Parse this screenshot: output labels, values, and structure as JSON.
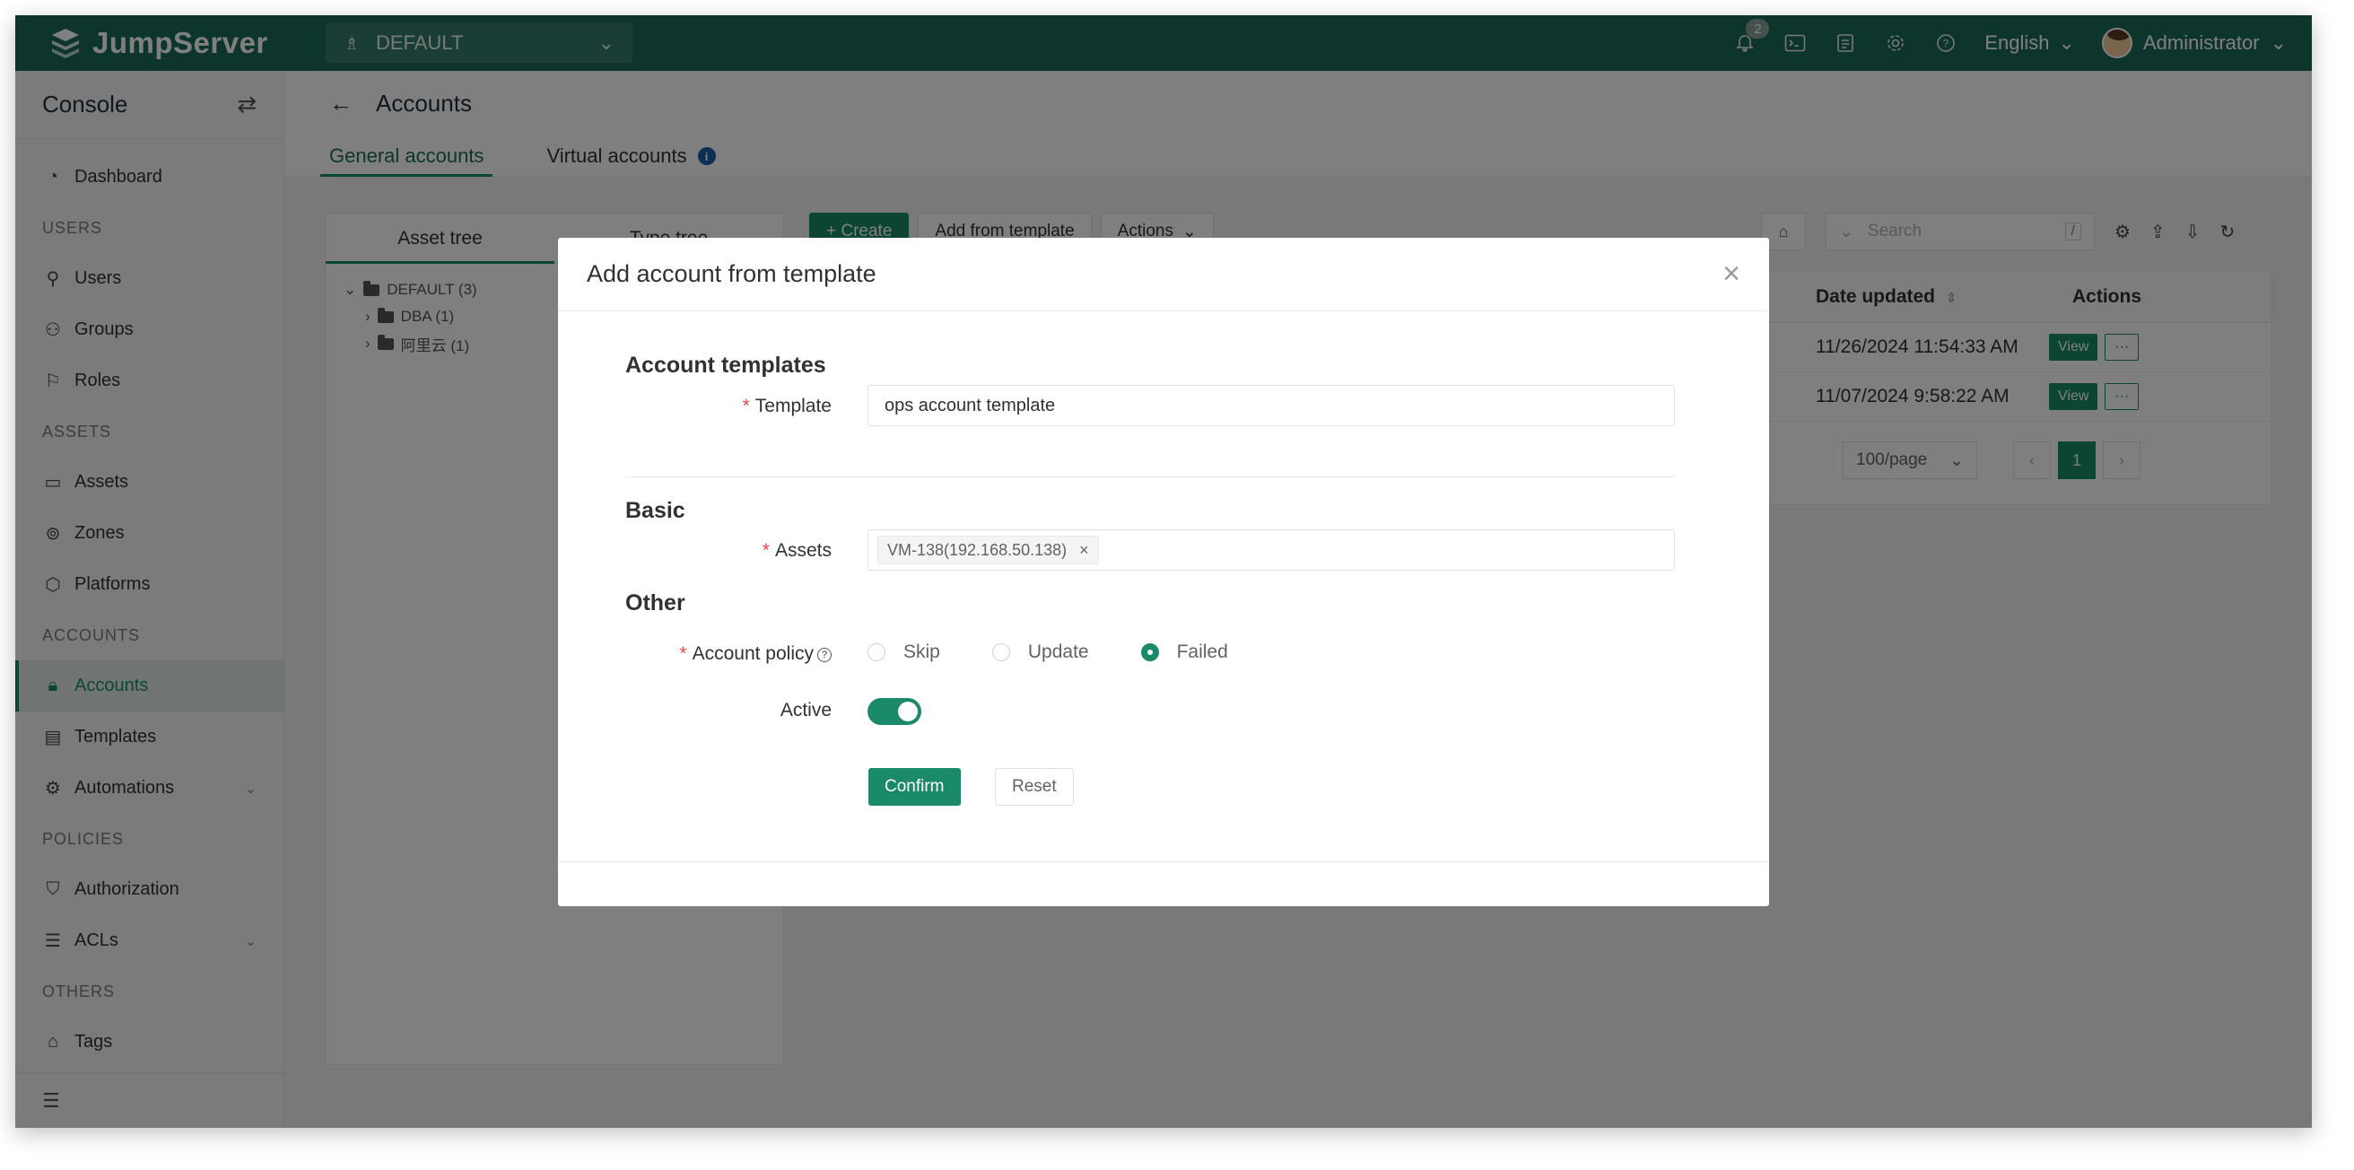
{
  "app": {
    "name": "JumpServer",
    "org": "DEFAULT"
  },
  "topbar": {
    "notifications_count": "2",
    "language": "English",
    "user": "Administrator"
  },
  "sidebar": {
    "title": "Console",
    "items": [
      {
        "label": "Dashboard"
      },
      {
        "section": "USERS"
      },
      {
        "label": "Users"
      },
      {
        "label": "Groups"
      },
      {
        "label": "Roles"
      },
      {
        "section": "ASSETS"
      },
      {
        "label": "Assets"
      },
      {
        "label": "Zones"
      },
      {
        "label": "Platforms"
      },
      {
        "section": "ACCOUNTS"
      },
      {
        "label": "Accounts"
      },
      {
        "label": "Templates"
      },
      {
        "label": "Automations"
      },
      {
        "section": "POLICIES"
      },
      {
        "label": "Authorization"
      },
      {
        "label": "ACLs"
      },
      {
        "section": "OTHERS"
      },
      {
        "label": "Tags"
      }
    ]
  },
  "page": {
    "title": "Accounts",
    "tabs": [
      "General accounts",
      "Virtual accounts"
    ],
    "tree_tabs": [
      "Asset tree",
      "Type tree"
    ],
    "tree": [
      {
        "label": "DEFAULT (3)"
      },
      {
        "label": "DBA (1)"
      },
      {
        "label": "阿里云 (1)"
      }
    ],
    "toolbar": {
      "create": "+ Create",
      "add_from_template": "Add from template",
      "actions": "Actions"
    },
    "search": {
      "placeholder": "Search",
      "shortcut": "/"
    },
    "table": {
      "headers": {
        "date_updated": "Date updated",
        "actions": "Actions"
      },
      "rows": [
        {
          "date_updated": "11/26/2024 11:54:33 AM",
          "view": "View",
          "more": "···"
        },
        {
          "date_updated": "11/07/2024 9:58:22 AM",
          "view": "View",
          "more": "···"
        }
      ],
      "page_size": "100/page",
      "current_page": "1"
    }
  },
  "modal": {
    "title": "Add account from template",
    "sections": {
      "templates": "Account templates",
      "basic": "Basic",
      "other": "Other"
    },
    "template_label": "Template",
    "template_value": "ops account template",
    "assets_label": "Assets",
    "assets_chip": "VM-138(192.168.50.138)",
    "policy_label": "Account policy",
    "policy_options": [
      "Skip",
      "Update",
      "Failed"
    ],
    "policy_selected": "Failed",
    "active_label": "Active",
    "active": true,
    "confirm": "Confirm",
    "reset": "Reset"
  },
  "colors": {
    "brand": "#1a6b56",
    "accent": "#1a8a6a",
    "required": "#e84a4a"
  }
}
